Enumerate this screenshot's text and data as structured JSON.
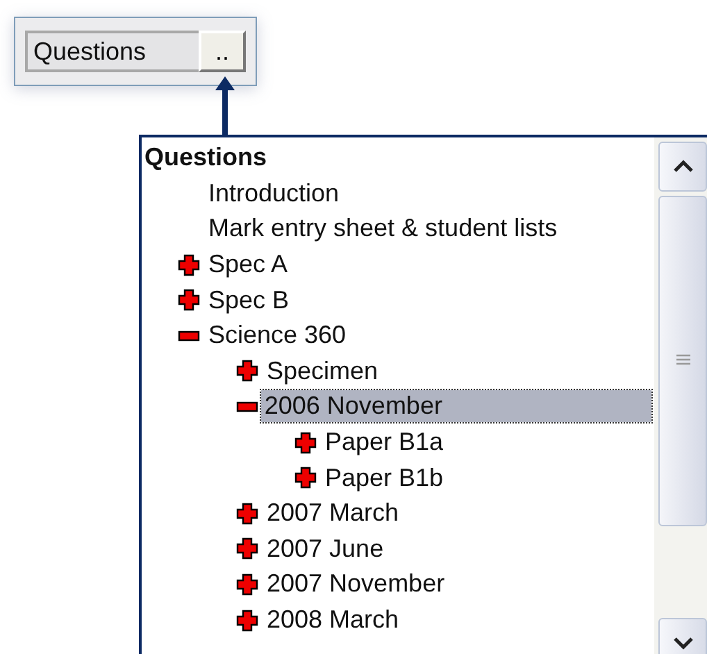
{
  "picker": {
    "value": "Questions",
    "button": ".."
  },
  "tree": {
    "root": "Questions",
    "items": [
      {
        "label": "Introduction",
        "selected": false
      },
      {
        "label": "Mark entry sheet & student lists",
        "selected": false
      },
      {
        "label": "Spec A",
        "expanded": false,
        "selected": false
      },
      {
        "label": "Spec B",
        "expanded": false,
        "selected": false
      },
      {
        "label": "Science 360",
        "expanded": true,
        "selected": false,
        "children": [
          {
            "label": "Specimen",
            "expanded": false,
            "selected": false
          },
          {
            "label": "2006 November",
            "expanded": true,
            "selected": true,
            "children": [
              {
                "label": "Paper B1a",
                "expanded": false,
                "selected": false
              },
              {
                "label": "Paper B1b",
                "expanded": false,
                "selected": false
              }
            ]
          },
          {
            "label": "2007 March",
            "expanded": false,
            "selected": false
          },
          {
            "label": "2007 June",
            "expanded": false,
            "selected": false
          },
          {
            "label": "2007 November",
            "expanded": false,
            "selected": false
          },
          {
            "label": "2008 March",
            "expanded": false,
            "selected": false
          }
        ]
      }
    ]
  }
}
